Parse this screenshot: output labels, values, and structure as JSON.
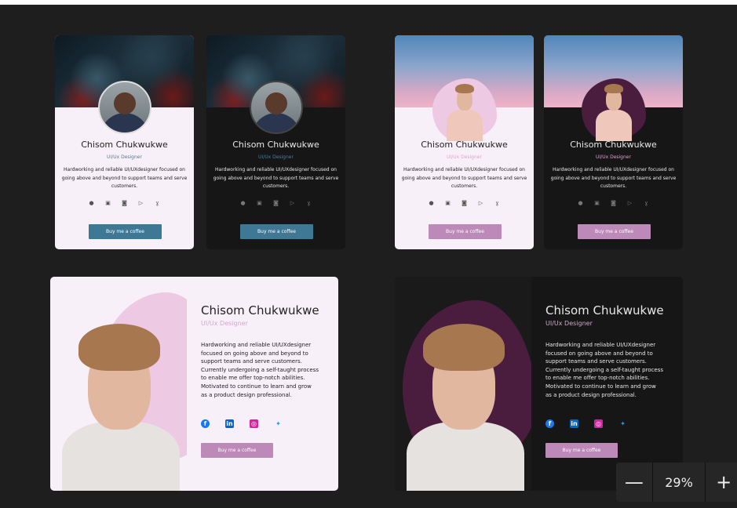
{
  "profile": {
    "name": "Chisom Chukwukwe",
    "role": "UI/Ux Designer",
    "short_bio": "Hardworking and reliable UI/UXdesigner focused on going above and beyond to support teams and serve customers.",
    "long_bio": "Hardworking and reliable UI/UXdesigner focused on going above and beyond to support teams and serve customers. Currently undergoing a self-taught process to enable me offer top-notch abilities. Motivated to continue to learn and grow as a product design professional.",
    "button_label": "Buy me a coffee"
  },
  "small_cards": [
    {
      "theme": "light",
      "header": "texture",
      "button_color": "#3f7894",
      "role_color": "#4d7d98"
    },
    {
      "theme": "dark",
      "header": "texture",
      "button_color": "#3f7894",
      "role_color": "#4d7d98"
    },
    {
      "theme": "light",
      "header": "sky",
      "button_color": "#bd89b8",
      "role_color": "#d7a6cc",
      "blob_color": "#eec9e3"
    },
    {
      "theme": "dark",
      "header": "sky",
      "button_color": "#bd89b8",
      "role_color": "#d7a6cc",
      "blob_color": "#4a1d3e"
    }
  ],
  "small_icons": [
    "facebook-icon",
    "linkedin-icon",
    "instagram-icon",
    "youtube-icon",
    "twitter-icon"
  ],
  "large_icons": [
    {
      "name": "facebook-icon",
      "color": "#1877f2",
      "glyph": "f"
    },
    {
      "name": "linkedin-icon",
      "color": "#0a66c2",
      "glyph": "in"
    },
    {
      "name": "instagram-icon",
      "color": "#d6249f",
      "glyph": "◎"
    },
    {
      "name": "twitter-icon",
      "color": "#1d9bf0",
      "glyph": "🐦"
    }
  ],
  "zoom": {
    "decrease": "—",
    "value": "29%",
    "increase": "+"
  }
}
